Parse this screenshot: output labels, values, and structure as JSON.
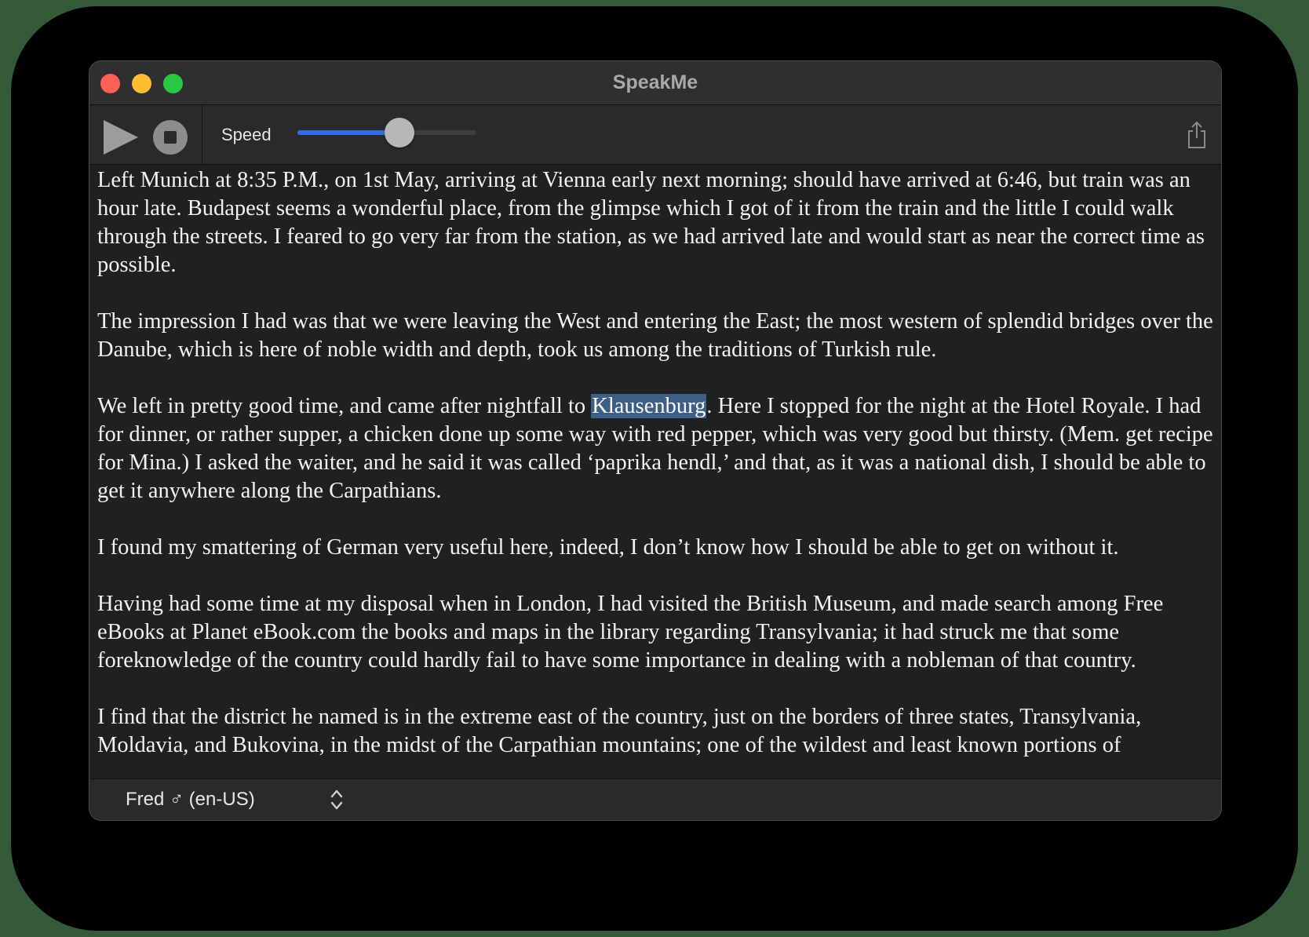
{
  "window": {
    "title": "SpeakMe"
  },
  "toolbar": {
    "play_icon": "play-icon",
    "stop_icon": "stop-icon",
    "speed_label": "Speed",
    "speed_level": 0.57,
    "share_icon": "share-icon"
  },
  "colors": {
    "accent": "#2f6fe4",
    "highlight": "#3d5e86",
    "close": "#fe5f57",
    "minimize": "#febc2e",
    "zoom": "#28c840"
  },
  "content": {
    "p1": "Left Munich at 8:35 P.M., on 1st May, arriving at Vienna early next morning; should have arrived at 6:46, but train was an hour late. Budapest seems a wonderful place, from the glimpse which I got of it from the train and the little I could walk through the streets. I feared to go very far from the station, as we had arrived late and would start as near the correct time as possible.",
    "p2": "The impression I had was that we were leaving the West and entering the East; the most western of splendid bridges over the Danube, which is here of noble width and depth, took us among the traditions of Turkish rule.",
    "p3_before": "We left in pretty good time, and came after nightfall to ",
    "p3_highlight": "Klausenburg",
    "p3_after": ". Here I stopped for the night at the Hotel Royale. I had for dinner, or rather supper, a chicken done up some way with red pepper, which was very good but thirsty. (Mem. get recipe for Mina.) I asked the waiter, and he said it was called ‘paprika hendl,’ and that, as it was a national dish, I should be able to get it anywhere along the Carpathians.",
    "p4": "I found my smattering of German very useful here, indeed, I don’t know how I should be able to get on without it.",
    "p5": "Having had some time at my disposal when in London, I had visited the British Museum, and made search among Free eBooks at Planet eBook.com the books and maps in the library regarding Transylvania; it had struck me that some foreknowledge of the country could hardly fail to have some importance in dealing with a nobleman of that country.",
    "p6": "I find that the district he named is in the extreme east of the country, just on the borders of three states, Transylvania, Moldavia, and Bukovina, in the midst of the Carpathian mountains; one of the wildest and least known portions of"
  },
  "footer": {
    "voice": "Fred ♂ (en-US)",
    "chevron_icon": "chevron-up-down-icon"
  }
}
